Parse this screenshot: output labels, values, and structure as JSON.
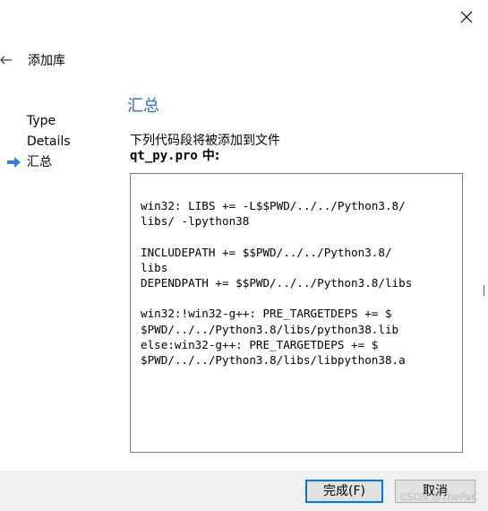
{
  "wizard": {
    "title": "添加库"
  },
  "steps": [
    {
      "label": "Type",
      "current": false
    },
    {
      "label": "Details",
      "current": false
    },
    {
      "label": "汇总",
      "current": true
    }
  ],
  "summary": {
    "heading": "汇总",
    "description": "下列代码段将被添加到文件",
    "filename": "qt_py.pro",
    "filename_suffix": " 中:",
    "snippet": "win32: LIBS += -L$$PWD/../../Python3.8/\nlibs/ -lpython38\n\nINCLUDEPATH += $$PWD/../../Python3.8/\nlibs\nDEPENDPATH += $$PWD/../../Python3.8/libs\n\nwin32:!win32-g++: PRE_TARGETDEPS += $\n$PWD/../../Python3.8/libs/python38.lib\nelse:win32-g++: PRE_TARGETDEPS += $\n$PWD/../../Python3.8/libs/libpython38.a"
  },
  "buttons": {
    "finish": "完成(F)",
    "cancel": "取消"
  },
  "watermark": "CSDN @ThePaK",
  "colors": {
    "heading": "#2f6bb4",
    "arrow": "#3a78d8",
    "primary_border": "#0078d7"
  },
  "icons": {
    "close": "close-icon",
    "back": "back-arrow-icon",
    "current_step": "current-step-arrow-icon"
  }
}
